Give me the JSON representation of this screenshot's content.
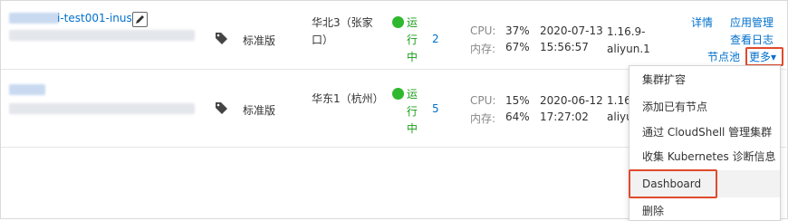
{
  "rows": [
    {
      "name_suffix": "i-test001-inuse",
      "edition": "标准版",
      "region": "华北3（张家口）",
      "status": "运行中",
      "nodes": "2",
      "cpu_label": "CPU:",
      "cpu": "37%",
      "mem_label": "内存:",
      "mem": "67%",
      "created_date": "2020-07-13",
      "created_time": "15:56:57",
      "version": "1.16.9-aliyun.1",
      "actions": {
        "details": "详情",
        "app_manage": "应用管理",
        "view_logs": "查看日志",
        "node_pool": "节点池",
        "more": "更多▾"
      }
    },
    {
      "edition": "标准版",
      "region": "华东1（杭州）",
      "status": "运行中",
      "nodes": "5",
      "cpu_label": "CPU:",
      "cpu": "15%",
      "mem_label": "内存:",
      "mem": "64%",
      "created_date": "2020-06-12",
      "created_time": "17:27:02",
      "version": "1.16",
      "version_line2": "aliyu"
    }
  ],
  "more_menu": {
    "items": [
      "集群扩容",
      "添加已有节点",
      "通过 CloudShell 管理集群",
      "收集 Kubernetes 诊断信息",
      "Dashboard",
      "删除"
    ]
  },
  "colors": {
    "link": "#0070cc",
    "running": "#2eb82e",
    "highlight": "#e04a2b"
  }
}
